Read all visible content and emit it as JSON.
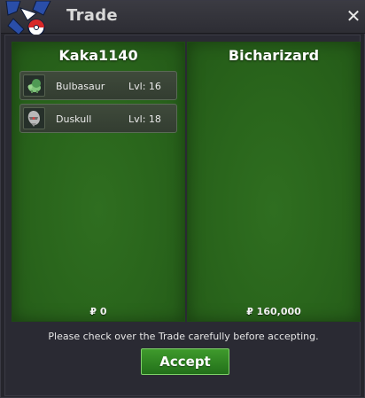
{
  "window": {
    "title": "Trade",
    "close_label": "✕"
  },
  "trade": {
    "left": {
      "name": "Kaka1140",
      "money": "₽ 0",
      "items": [
        {
          "name": "Bulbasaur",
          "level": "Lvl: 16",
          "icon": "bulbasaur-icon"
        },
        {
          "name": "Duskull",
          "level": "Lvl: 18",
          "icon": "duskull-icon"
        }
      ]
    },
    "right": {
      "name": "Bicharizard",
      "money": "₽ 160,000",
      "items": []
    }
  },
  "notice": "Please check over the Trade carefully before accepting.",
  "accept_label": "Accept",
  "colors": {
    "panel_green": "#2a661c",
    "button_green": "#2f8a22",
    "title_text": "#d8d8d8"
  }
}
